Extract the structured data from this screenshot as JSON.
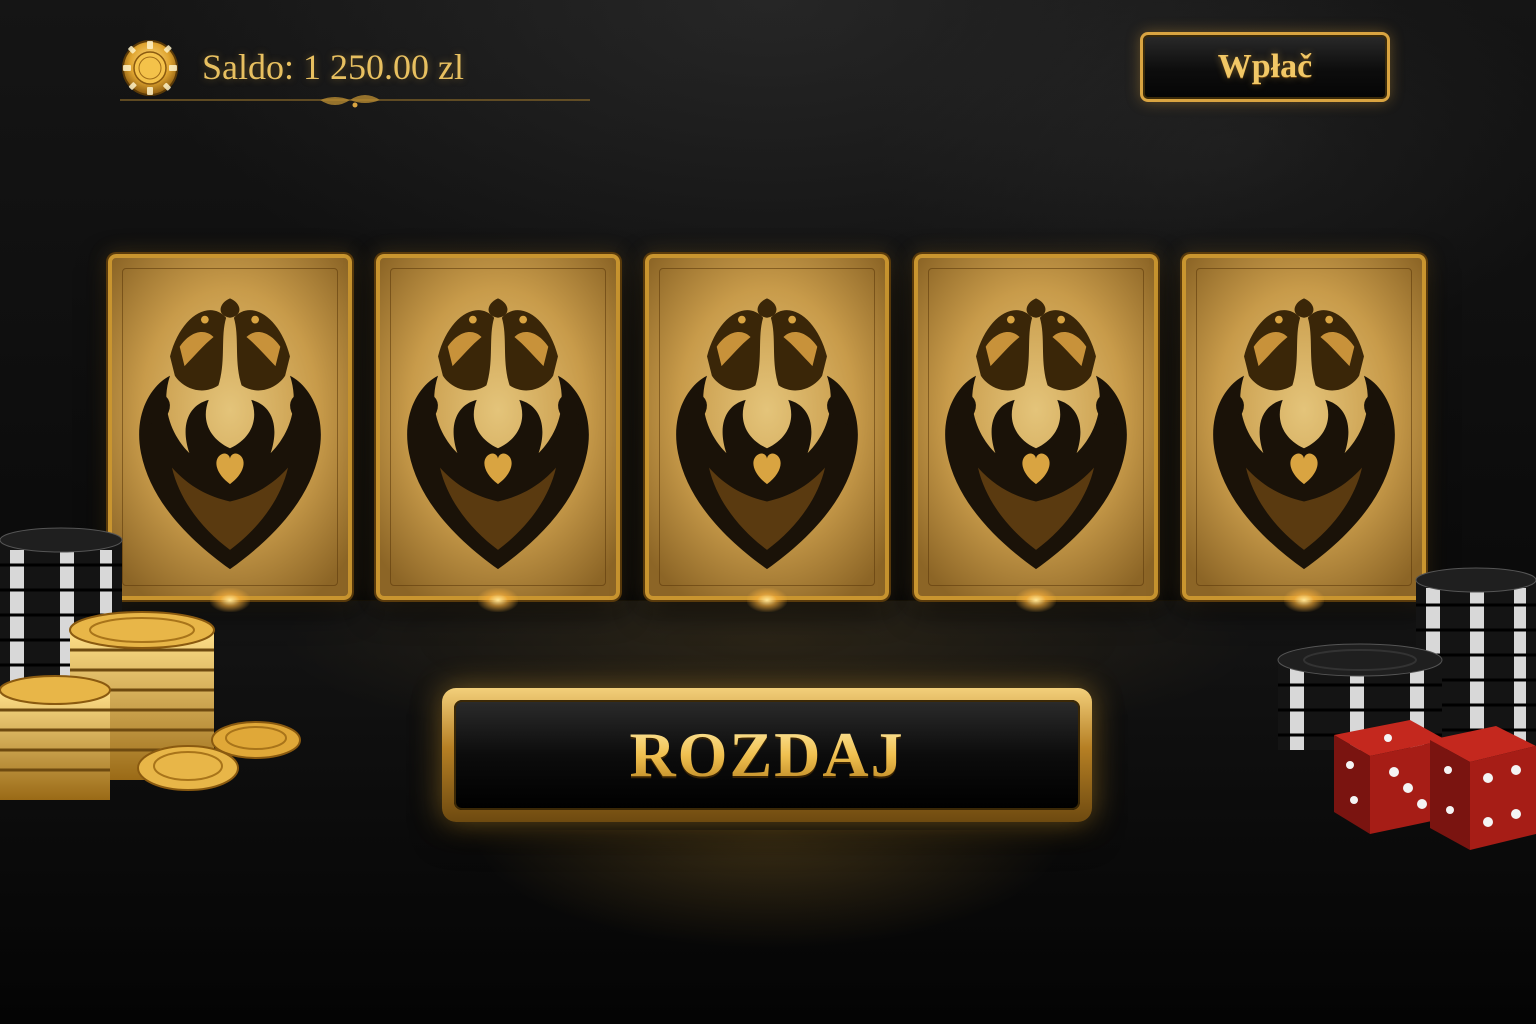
{
  "balance": {
    "label": "Saldo: 1 250.00 zl",
    "icon": "gold-chip-icon"
  },
  "header": {
    "deposit_label": "Wpłač"
  },
  "cards": [
    {
      "name": "card-back-1",
      "state": "face-down"
    },
    {
      "name": "card-back-2",
      "state": "face-down"
    },
    {
      "name": "card-back-3",
      "state": "face-down"
    },
    {
      "name": "card-back-4",
      "state": "face-down"
    },
    {
      "name": "card-back-5",
      "state": "face-down"
    }
  ],
  "actions": {
    "deal_label": "ROZDAJ"
  },
  "decor": {
    "left": "poker-chip-stacks-and-gold-coins",
    "right": "poker-chip-stacks-and-red-dice"
  },
  "colors": {
    "accent_gold": "#d9a441",
    "text_gold": "#f2c866",
    "background": "#0b0b0b",
    "dice_red": "#9e1a14"
  }
}
